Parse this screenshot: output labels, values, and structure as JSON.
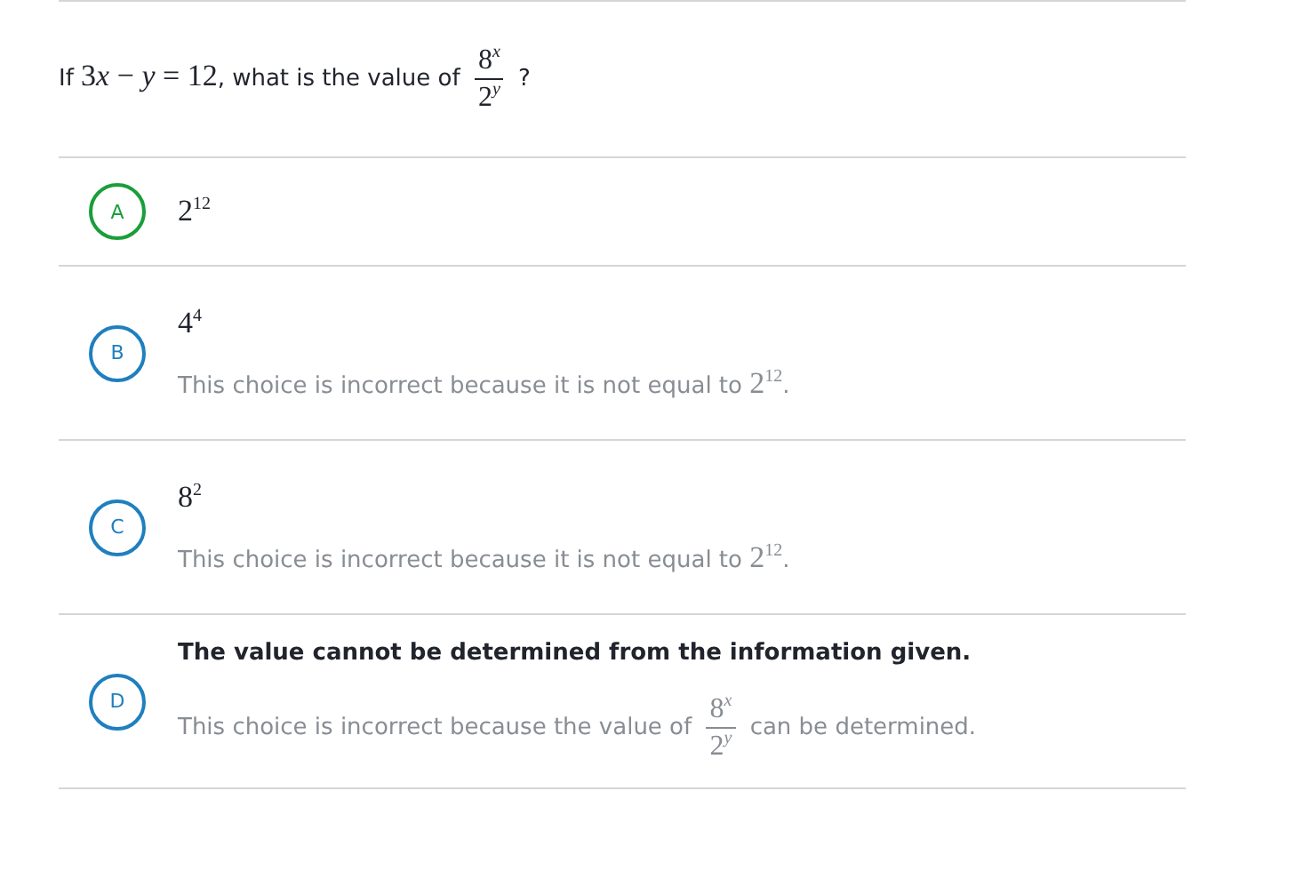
{
  "question": {
    "segments": [
      {
        "kind": "text",
        "text": "If "
      },
      {
        "kind": "math",
        "text": "3"
      },
      {
        "kind": "variable",
        "text": "x"
      },
      {
        "kind": "math",
        "text": " − "
      },
      {
        "kind": "variable",
        "text": "y"
      },
      {
        "kind": "math",
        "text": " = 12"
      },
      {
        "kind": "text",
        "text": ", what is the value of "
      },
      {
        "kind": "fraction",
        "numerator": "8$^{x}$",
        "denominator": "2$^{y}$"
      },
      {
        "kind": "text",
        "text": " ?"
      }
    ]
  },
  "choices": [
    {
      "letter": "A",
      "correct": true,
      "answer": {
        "kind": "math",
        "text": "2$^{12}$"
      }
    },
    {
      "letter": "B",
      "correct": false,
      "answer": {
        "kind": "math",
        "text": "4$^{4}$"
      },
      "explanation": [
        {
          "kind": "text",
          "text": "This choice is incorrect because it is not equal to "
        },
        {
          "kind": "math",
          "text": "2$^{12}$"
        },
        {
          "kind": "text",
          "text": "."
        }
      ]
    },
    {
      "letter": "C",
      "correct": false,
      "answer": {
        "kind": "math",
        "text": "8$^{2}$"
      },
      "explanation": [
        {
          "kind": "text",
          "text": "This choice is incorrect because it is not equal to "
        },
        {
          "kind": "math",
          "text": "2$^{12}$"
        },
        {
          "kind": "text",
          "text": "."
        }
      ]
    },
    {
      "letter": "D",
      "correct": false,
      "answer": {
        "kind": "text",
        "text": "The value cannot be determined from the information given."
      },
      "explanation": [
        {
          "kind": "text",
          "text": "This choice is incorrect because the value of "
        },
        {
          "kind": "fraction",
          "numerator": "8$^{x}$",
          "denominator": "2$^{y}$"
        },
        {
          "kind": "text",
          "text": " can be determined."
        }
      ]
    }
  ]
}
